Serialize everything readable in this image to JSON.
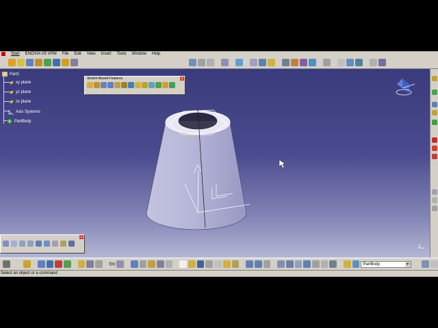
{
  "menu": {
    "items": [
      "Start",
      "ENOVIA V5 VPM",
      "File",
      "Edit",
      "View",
      "Insert",
      "Tools",
      "Window",
      "Help"
    ]
  },
  "tree": {
    "root": "Part1",
    "items": [
      "xy plane",
      "yz plane",
      "zx plane",
      "Axis Systems",
      "PartBody"
    ]
  },
  "floating_toolbar": {
    "title": "Sketch-Based Features",
    "close": "x"
  },
  "view_toolbar": {
    "close": "x"
  },
  "bottom_toolbar": {
    "fx_label": "f(x)",
    "current_body": "PartBody"
  },
  "status": {
    "message": "Select an object or a command"
  },
  "colors": {
    "ui_gray": "#d4d0c8",
    "viewport_top": "#3a3b7c",
    "viewport_bottom": "#b4b6d4",
    "part_face": "#b8b8d8"
  }
}
